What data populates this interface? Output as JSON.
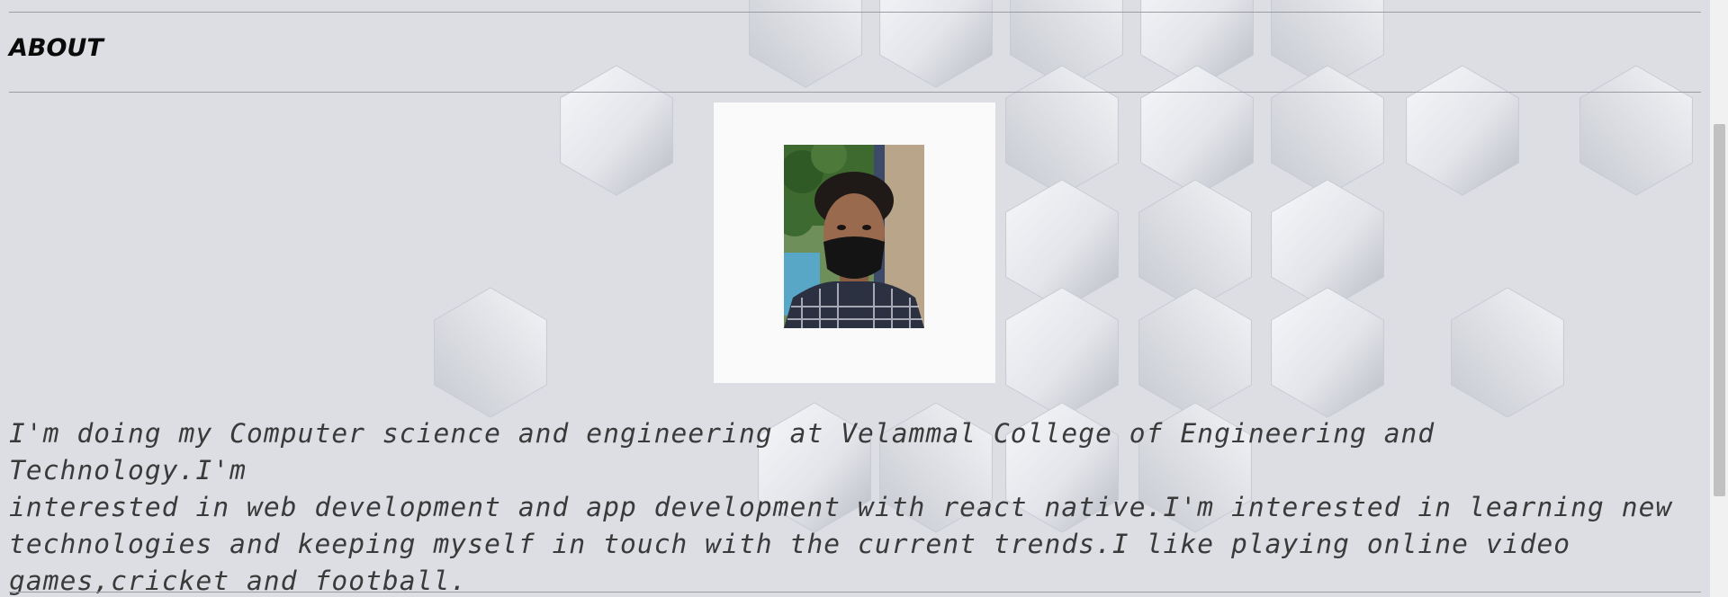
{
  "section": {
    "heading": "ABOUT",
    "photo_icon": "profile-photo",
    "bio": "I'm doing my Computer science and engineering at Velammal College of Engineering and Technology.I'm\ninterested in web development and app development with react native.I'm interested in learning new\ntechnologies and keeping myself in touch with the current trends.I like playing online video\ngames,cricket and football."
  },
  "colors": {
    "background": "#dcdee4",
    "heading": "#0a0a0a",
    "text": "#3a3a3a",
    "frame": "#fafafa"
  }
}
